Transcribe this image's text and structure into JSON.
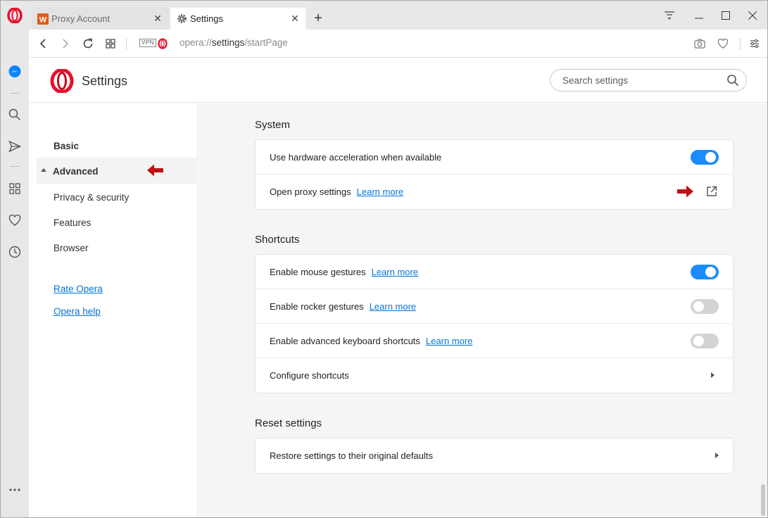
{
  "browser": {
    "tabs": [
      {
        "label": "Proxy Account",
        "active": false
      },
      {
        "label": "Settings",
        "active": true
      }
    ],
    "address": {
      "vpn_badge": "VPN",
      "scheme": "opera://",
      "host": "settings",
      "path": "/startPage"
    }
  },
  "settings": {
    "header_title": "Settings",
    "search_placeholder": "Search settings",
    "nav": {
      "basic": "Basic",
      "advanced": "Advanced",
      "privacy": "Privacy & security",
      "features": "Features",
      "browser": "Browser",
      "rate": "Rate Opera",
      "help": "Opera help"
    },
    "sections": {
      "system": {
        "title": "System",
        "hw_accel": {
          "label": "Use hardware acceleration when available",
          "enabled": true
        },
        "proxy": {
          "label": "Open proxy settings",
          "learn_more": "Learn more"
        }
      },
      "shortcuts": {
        "title": "Shortcuts",
        "mouse": {
          "label": "Enable mouse gestures",
          "learn_more": "Learn more",
          "enabled": true
        },
        "rocker": {
          "label": "Enable rocker gestures",
          "learn_more": "Learn more",
          "enabled": false
        },
        "keyboard": {
          "label": "Enable advanced keyboard shortcuts",
          "learn_more": "Learn more",
          "enabled": false
        },
        "configure": {
          "label": "Configure shortcuts"
        }
      },
      "reset": {
        "title": "Reset settings",
        "restore": {
          "label": "Restore settings to their original defaults"
        }
      }
    }
  },
  "colors": {
    "toggle_on": "#1a8cff",
    "toggle_off": "#d3d3d3",
    "link": "#0275d8",
    "annotation_arrow": "#c0100f",
    "opera_red": "#e8102b"
  }
}
